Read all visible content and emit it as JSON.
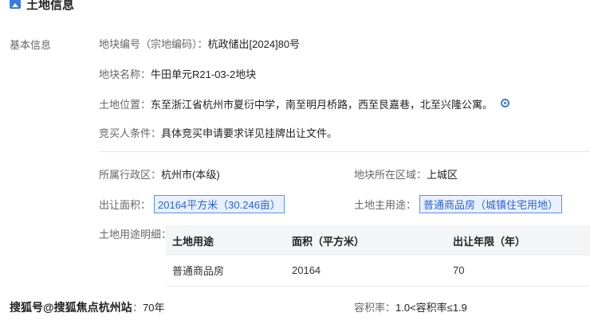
{
  "header": {
    "title": "土地信息"
  },
  "section_label": "基本信息",
  "fields": {
    "parcel_no": {
      "label": "地块编号（宗地编码）：",
      "value": "杭政储出[2024]80号"
    },
    "parcel_name": {
      "label": "地块名称：",
      "value": "牛田单元R21-03-2地块"
    },
    "location": {
      "label": "土地位置：",
      "value": "东至浙江省杭州市夏衍中学，南至明月桥路，西至艮嘉巷，北至兴隆公寓。",
      "icon": "location-icon"
    },
    "bidder_cond": {
      "label": "竞买人条件：",
      "value": "具体竞买申请要求详见挂牌出让文件。"
    },
    "admin_region": {
      "label": "所属行政区：",
      "value": "杭州市(本级)"
    },
    "parcel_area_region": {
      "label": "地块所在区域：",
      "value": "上城区"
    },
    "transfer_area": {
      "label": "出让面积：",
      "value": "20164平方米（30.246亩）"
    },
    "main_use": {
      "label": "土地主用途：",
      "value": "普通商品房（城镇住宅用地）"
    },
    "usage_detail_label": "土地用途明细：",
    "transfer_years": {
      "label_suffix": "：",
      "value": "70年"
    },
    "plot_ratio": {
      "label": "容积率：",
      "value": "1.0<容积率≤1.9"
    }
  },
  "usage_table": {
    "headers": [
      "土地用途",
      "面积（平方米）",
      "出让年限（年）"
    ],
    "rows": [
      [
        "普通商品房",
        "20164",
        "70"
      ]
    ]
  },
  "watermark": "搜狐号@搜狐焦点杭州站"
}
